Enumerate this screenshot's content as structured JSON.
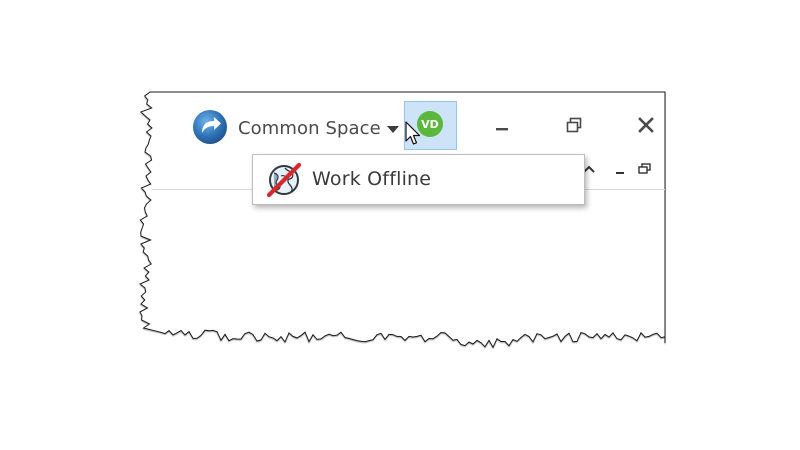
{
  "titlebar": {
    "logo_icon": "circular-arrow-logo-icon",
    "space_label": "Common Space",
    "space_caret_icon": "caret-down-icon",
    "user_initials": "VD",
    "avatar_color": "#5cb83c",
    "minimize_icon": "minimize-icon",
    "restore_icon": "restore-icon",
    "close_icon": "close-icon"
  },
  "user_menu": {
    "items": [
      {
        "label": "Work Offline",
        "icon": "globe-offline-icon"
      }
    ]
  },
  "colors": {
    "accent_logo": "#2f74b8",
    "avatar_button_bg": "#cde3f7",
    "offline_strike": "#d9272e"
  }
}
